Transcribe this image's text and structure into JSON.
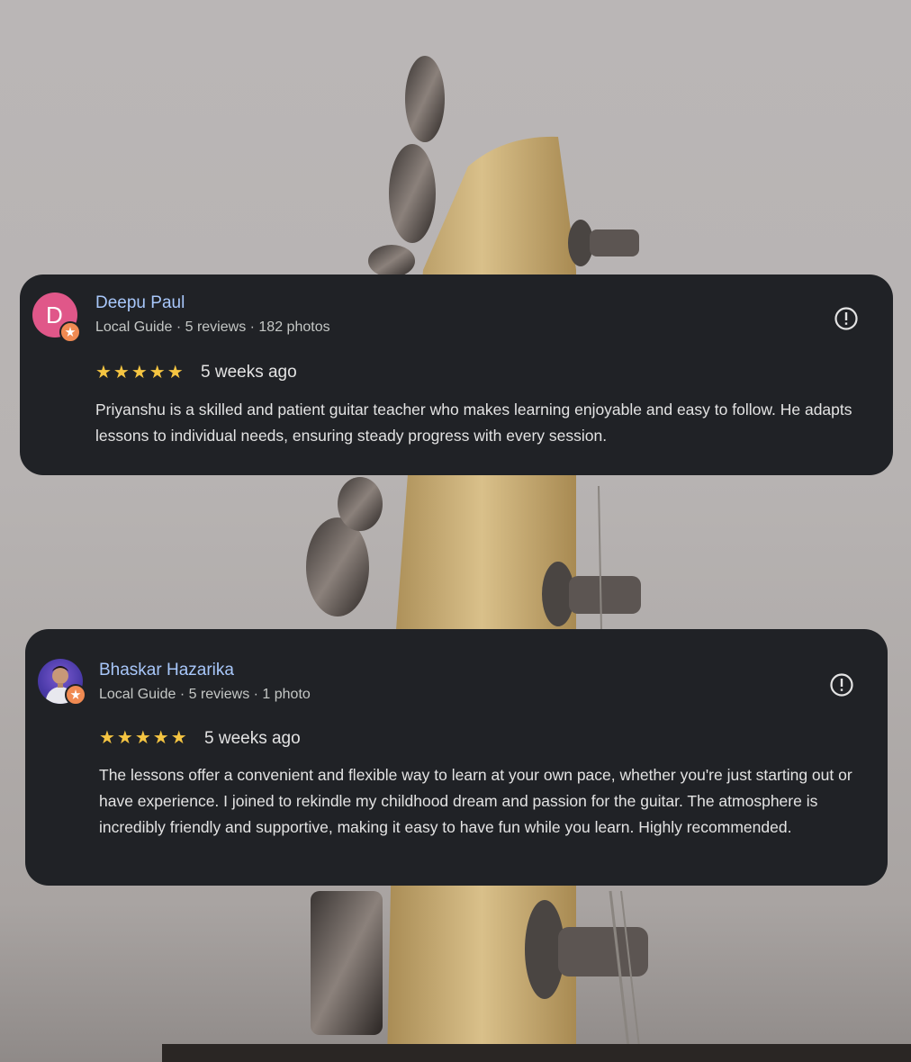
{
  "reviews": [
    {
      "author": "Deepu Paul",
      "avatar_letter": "D",
      "meta": "Local Guide · 5 reviews · 182 photos",
      "rating": "★★★★★",
      "rating_value": 5,
      "time_ago": "5 weeks ago",
      "text": "Priyanshu is a skilled and patient guitar teacher who makes learning enjoyable and easy to follow. He adapts lessons to individual needs, ensuring steady progress with every session."
    },
    {
      "author": "Bhaskar Hazarika",
      "meta": "Local Guide · 5 reviews · 1 photo",
      "rating": "★★★★★",
      "rating_value": 5,
      "time_ago": "5 weeks ago",
      "text": "The lessons offer a convenient and flexible way to learn at your own pace, whether you're just starting out or have experience. I joined to rekindle my childhood dream and passion for the guitar. The atmosphere is incredibly friendly and supportive, making it easy to have fun while you learn. Highly recommended."
    }
  ],
  "icons": {
    "report": "report-flag-icon",
    "local_guide_badge": "local-guide-badge-icon",
    "star": "star-icon"
  },
  "colors": {
    "card_bg": "#202226",
    "author_name": "#a8c7fa",
    "star": "#f5c542",
    "avatar_letter_bg": "#e05789",
    "badge": "#f08a52"
  }
}
